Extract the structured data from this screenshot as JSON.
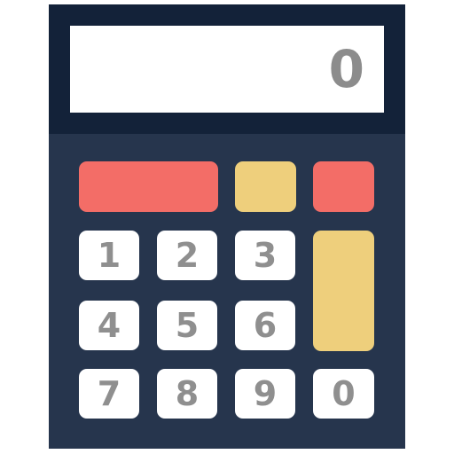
{
  "display": {
    "value": "0"
  },
  "keys": {
    "digits": [
      "1",
      "2",
      "3",
      "4",
      "5",
      "6",
      "7",
      "8",
      "9",
      "0"
    ]
  },
  "colors": {
    "body": "#26354d",
    "bezel": "#132239",
    "screen": "#ffffff",
    "red_key": "#f36d67",
    "yellow_key": "#eecf7c",
    "digit_key": "#ffffff",
    "digit_text": "#8f8f8f"
  }
}
